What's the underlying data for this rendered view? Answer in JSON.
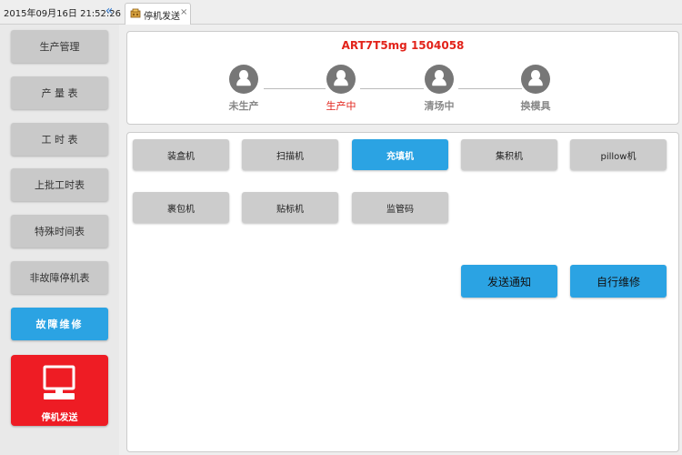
{
  "header": {
    "datetime": "2015年09月16日 21:52:26",
    "collapse_icon": "«",
    "tab": {
      "label": "停机发送",
      "close": "×",
      "icon": "machine-icon"
    }
  },
  "sidebar": {
    "items": [
      {
        "label": "生产管理"
      },
      {
        "label": "产 量 表"
      },
      {
        "label": "工 时 表"
      },
      {
        "label": "上批工时表"
      },
      {
        "label": "特殊时间表"
      },
      {
        "label": "非故障停机表"
      },
      {
        "label": "故障维修",
        "active": true
      }
    ],
    "big_button": {
      "label": "停机发送",
      "icon": "computer-icon",
      "color": "#ee1c24"
    }
  },
  "status": {
    "title": "ART7T5mg 1504058",
    "steps": [
      {
        "label": "未生产"
      },
      {
        "label": "生产中",
        "current": true
      },
      {
        "label": "清场中"
      },
      {
        "label": "换模具"
      }
    ]
  },
  "machines": {
    "items": [
      {
        "label": "装盒机"
      },
      {
        "label": "扫描机"
      },
      {
        "label": "充填机",
        "active": true
      },
      {
        "label": "集积机"
      },
      {
        "label": "pillow机"
      },
      {
        "label": "裹包机"
      },
      {
        "label": "贴标机"
      },
      {
        "label": "监管码"
      }
    ]
  },
  "actions": {
    "send_notice": "发送通知",
    "self_repair": "自行维修"
  },
  "colors": {
    "accent": "#2ba3e3",
    "alert": "#ee1c24",
    "title": "#e2231a"
  }
}
